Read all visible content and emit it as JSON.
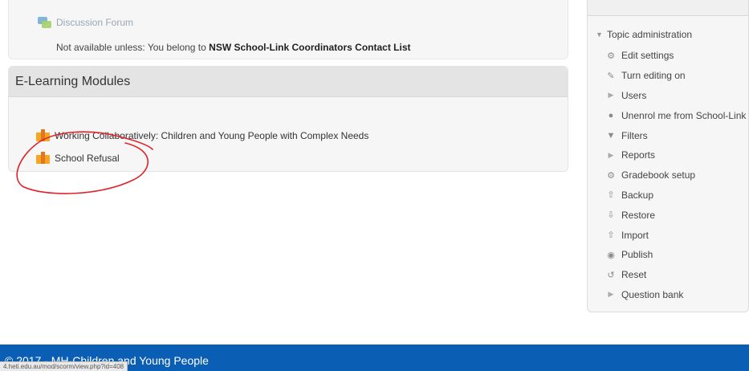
{
  "forum": {
    "title": "Discussion Forum",
    "restriction_prefix": "Not available unless: You belong to ",
    "restriction_group": "NSW School-Link Coordinators Contact List"
  },
  "section": {
    "title": "E-Learning Modules",
    "modules": [
      {
        "label": "Working Collaboratively: Children and Young People with Complex Needs",
        "icon": "scorm-package-icon"
      },
      {
        "label": "School Refusal",
        "icon": "scorm-package-icon"
      }
    ]
  },
  "annotation": {
    "color": "#e0232b"
  },
  "sidebar": {
    "admin_title": "Topic administration",
    "items": [
      {
        "label": "Edit settings",
        "icon": "gear-icon"
      },
      {
        "label": "Turn editing on",
        "icon": "pencil-icon"
      },
      {
        "label": "Users",
        "icon": "expand-arrow-icon"
      },
      {
        "label": "Unenrol me from School-Link",
        "icon": "user-icon"
      },
      {
        "label": "Filters",
        "icon": "filter-icon"
      },
      {
        "label": "Reports",
        "icon": "expand-arrow-icon"
      },
      {
        "label": "Gradebook setup",
        "icon": "gear-icon"
      },
      {
        "label": "Backup",
        "icon": "upload-icon"
      },
      {
        "label": "Restore",
        "icon": "download-icon"
      },
      {
        "label": "Import",
        "icon": "upload-icon"
      },
      {
        "label": "Publish",
        "icon": "globe-icon"
      },
      {
        "label": "Reset",
        "icon": "reset-icon"
      },
      {
        "label": "Question bank",
        "icon": "expand-arrow-icon"
      }
    ]
  },
  "footer": {
    "copyright": "© 2017 - MH-Children and Young People",
    "status_url": "4.heti.edu.au/mod/scorm/view.php?id=408"
  },
  "colors": {
    "footer": "#0a5fb4",
    "scorm_icon": "#f5a623",
    "annotation": "#e0232b"
  }
}
